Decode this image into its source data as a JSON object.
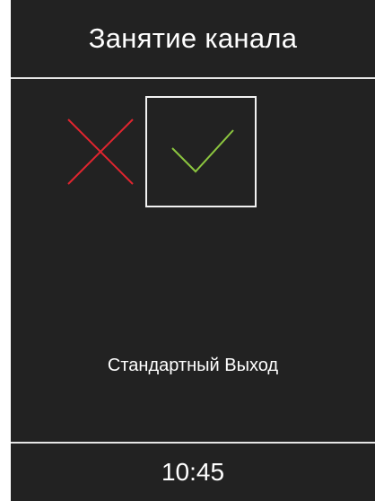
{
  "header": {
    "title": "Занятие канала"
  },
  "options": {
    "reject": {
      "icon": "cross-icon",
      "color": "#e0252f",
      "selected": false
    },
    "accept": {
      "icon": "checkmark-icon",
      "color": "#8cc63f",
      "selected": true
    }
  },
  "status": {
    "text": "Стандартный Выход"
  },
  "footer": {
    "time": "10:45"
  }
}
